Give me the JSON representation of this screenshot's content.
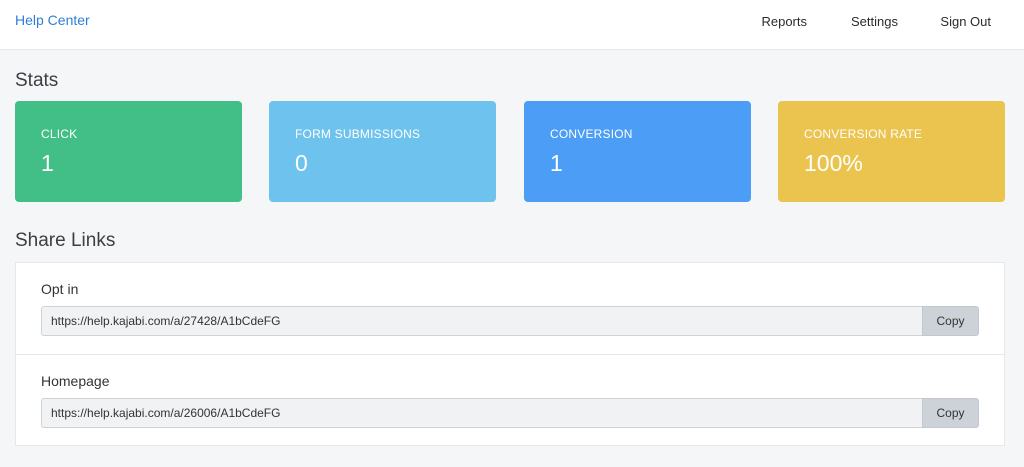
{
  "header": {
    "brand": "Help Center",
    "nav": [
      "Reports",
      "Settings",
      "Sign Out"
    ]
  },
  "stats": {
    "title": "Stats",
    "cards": [
      {
        "label": "CLICK",
        "value": "1",
        "color": "#41bf87"
      },
      {
        "label": "FORM SUBMISSIONS",
        "value": "0",
        "color": "#6ec3ee"
      },
      {
        "label": "CONVERSION",
        "value": "1",
        "color": "#4c9df6"
      },
      {
        "label": "CONVERSION RATE",
        "value": "100%",
        "color": "#ebc34f"
      }
    ]
  },
  "share_links": {
    "title": "Share Links",
    "items": [
      {
        "label": "Opt in",
        "url": "https://help.kajabi.com/a/27428/A1bCdeFG",
        "button": "Copy"
      },
      {
        "label": "Homepage",
        "url": "https://help.kajabi.com/a/26006/A1bCdeFG",
        "button": "Copy"
      }
    ]
  }
}
